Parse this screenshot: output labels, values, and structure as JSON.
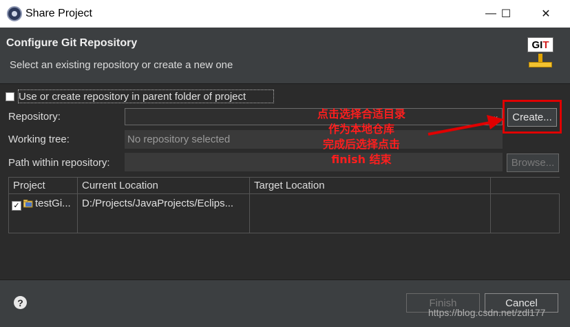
{
  "window": {
    "title": "Share Project",
    "minimize": "—",
    "maximize": "☐",
    "close": "✕"
  },
  "header": {
    "title": "Configure Git Repository",
    "description": "Select an existing repository or create a new one",
    "logo_text_g": "GI",
    "logo_text_t": "T"
  },
  "form": {
    "parent_folder_checkbox": "Use or create repository in parent folder of project",
    "parent_folder_checked": false,
    "repository_label": "Repository:",
    "repository_value": "",
    "create_button": "Create...",
    "working_tree_label": "Working tree:",
    "working_tree_value": "No repository selected",
    "path_label": "Path within repository:",
    "path_value": "",
    "browse_button": "Browse..."
  },
  "table": {
    "columns": [
      "Project",
      "Current Location",
      "Target Location",
      ""
    ],
    "rows": [
      {
        "checked": true,
        "project": "testGi...",
        "current": "D:/Projects/JavaProjects/Eclips...",
        "target": ""
      }
    ]
  },
  "footer": {
    "help": "?",
    "finish_button": "Finish",
    "cancel_button": "Cancel"
  },
  "annotation": {
    "lines": [
      "点击选择合适目录",
      "作为本地仓库",
      "完成后选择点击",
      "finish  结束"
    ],
    "color": "#ff1e1e"
  },
  "watermark": "https://blog.csdn.net/zdl177",
  "colors": {
    "dark_bg": "#2b2b2b",
    "panel_bg": "#3c3f41",
    "annotation_red": "#e00000"
  }
}
